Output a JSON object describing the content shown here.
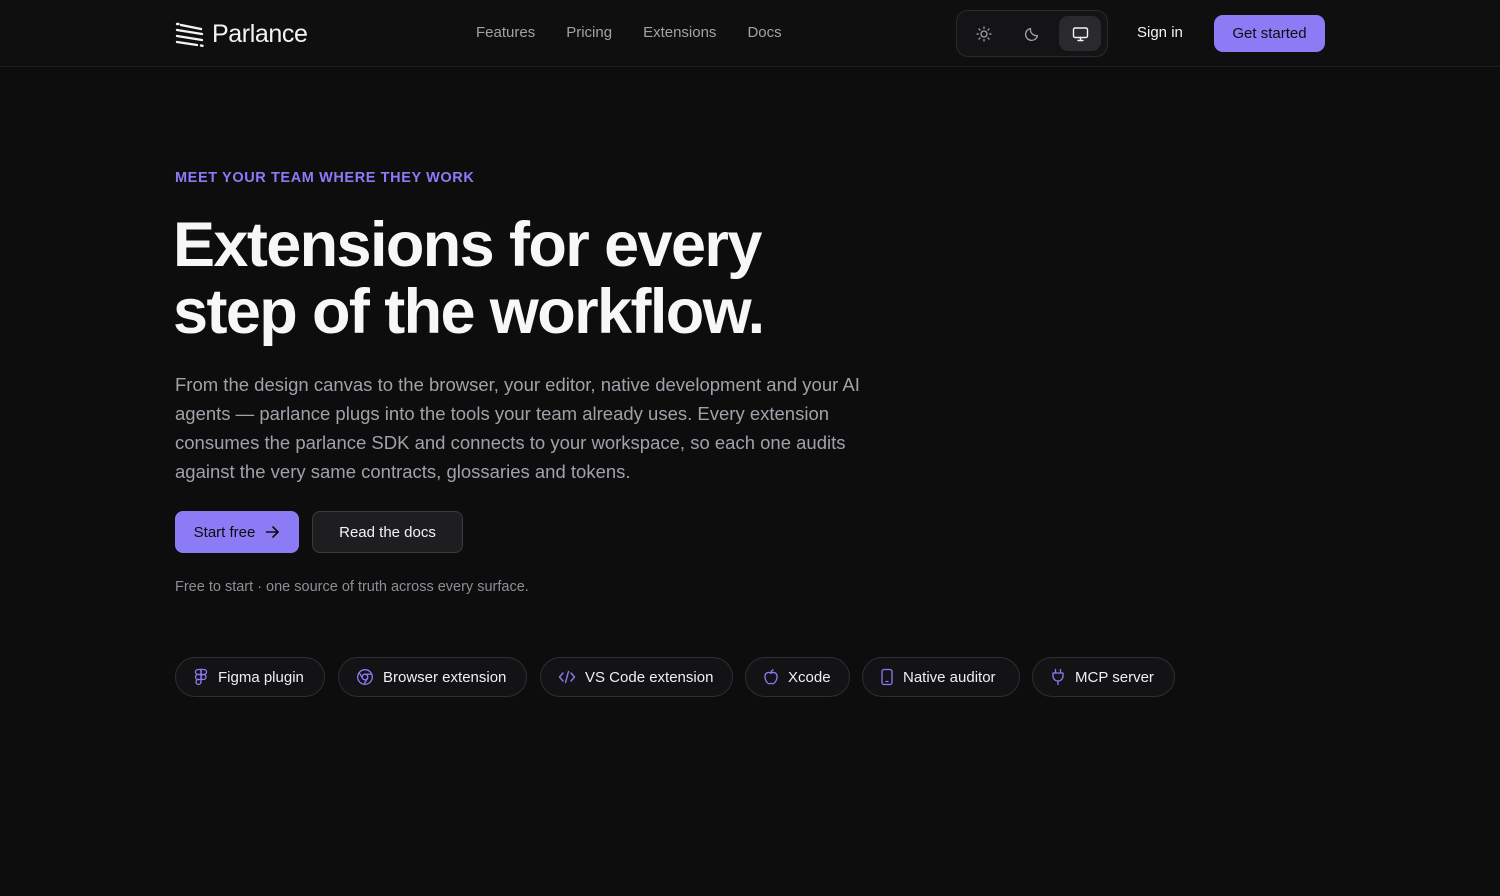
{
  "header": {
    "brand": "Parlance",
    "nav": [
      "Features",
      "Pricing",
      "Extensions",
      "Docs"
    ],
    "theme_options": [
      "light",
      "dark",
      "system"
    ],
    "theme_selected": "system",
    "sign_in": "Sign in",
    "get_started": "Get started"
  },
  "hero": {
    "eyebrow": "MEET YOUR TEAM WHERE THEY WORK",
    "headline_line1": "Extensions for every",
    "headline_line2": "step of the workflow.",
    "description": "From the design canvas to the browser, your editor, native development and your AI agents — parlance plugs into the tools your team already uses. Every extension consumes the parlance SDK and connects to your workspace, so each one audits against the very same contracts, glossaries and tokens.",
    "primary_cta": "Start free",
    "secondary_cta": "Read the docs",
    "fine_print": "Free to start · one source of truth across every surface."
  },
  "extensions": [
    {
      "label": "Figma plugin",
      "icon": "figma-icon"
    },
    {
      "label": "Browser extension",
      "icon": "chrome-icon"
    },
    {
      "label": "VS Code extension",
      "icon": "code-icon"
    },
    {
      "label": "Xcode",
      "icon": "apple-icon"
    },
    {
      "label": "Native auditor",
      "icon": "phone-icon"
    },
    {
      "label": "MCP server",
      "icon": "plug-icon"
    }
  ],
  "colors": {
    "accent": "#8b7cf6",
    "background": "#0d0d0e",
    "muted_text": "#a1a1aa"
  }
}
